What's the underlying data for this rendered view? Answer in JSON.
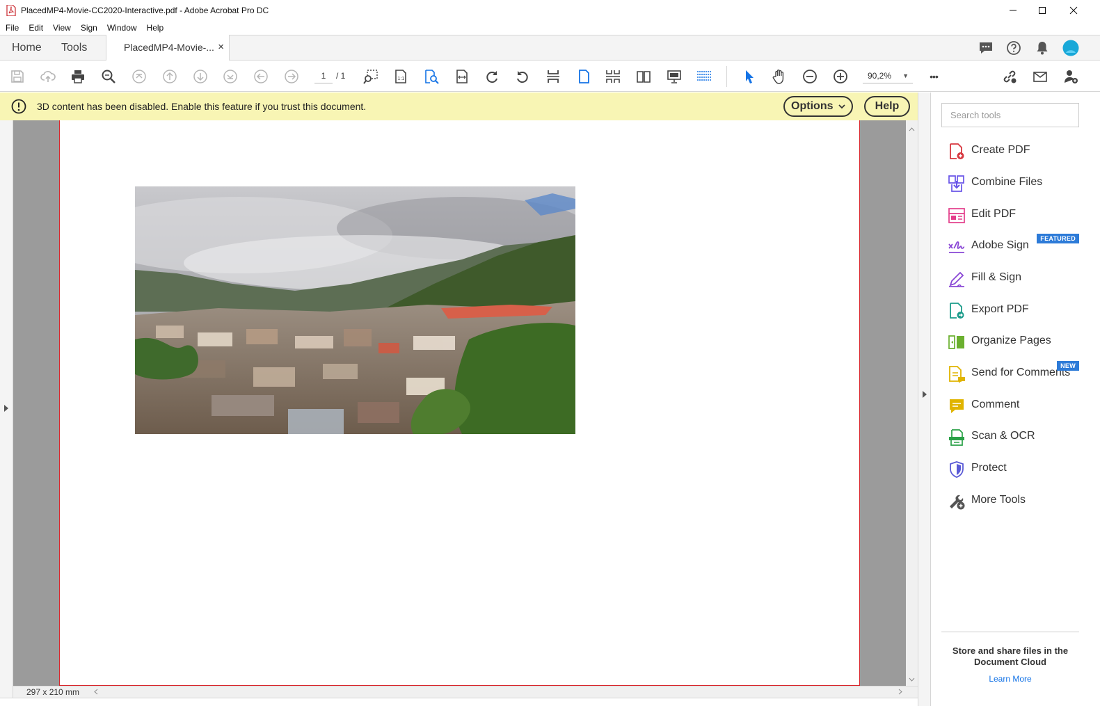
{
  "window": {
    "title": "PlacedMP4-Movie-CC2020-Interactive.pdf - Adobe Acrobat Pro DC",
    "controls": [
      "minimize-icon",
      "maximize-icon",
      "close-icon"
    ]
  },
  "menu": [
    "File",
    "Edit",
    "View",
    "Sign",
    "Window",
    "Help"
  ],
  "tabs": {
    "home": "Home",
    "tools": "Tools",
    "document": "PlacedMP4-Movie-...",
    "close_glyph": "×"
  },
  "toolbar": {
    "page_current": "1",
    "page_total": "/ 1",
    "zoom": "90,2%",
    "more": "•••"
  },
  "banner": {
    "message": "3D content has been disabled. Enable this feature if you trust this document.",
    "options_label": "Options",
    "help_label": "Help",
    "color": "#f8f5b4"
  },
  "document": {
    "page_size": "297 x 210 mm",
    "page_border_color": "#d7262c"
  },
  "tools_pane": {
    "search_placeholder": "Search tools",
    "items": [
      {
        "label": "Create PDF",
        "icon": "create-pdf-icon",
        "color": "#d7373f"
      },
      {
        "label": "Combine Files",
        "icon": "combine-files-icon",
        "color": "#6955e8"
      },
      {
        "label": "Edit PDF",
        "icon": "edit-pdf-icon",
        "color": "#e33d8a"
      },
      {
        "label": "Adobe Sign",
        "icon": "adobe-sign-icon",
        "color": "#8a47d6",
        "badge": "FEATURED"
      },
      {
        "label": "Fill & Sign",
        "icon": "fill-sign-icon",
        "color": "#8a47d6"
      },
      {
        "label": "Export PDF",
        "icon": "export-pdf-icon",
        "color": "#1c9c8b"
      },
      {
        "label": "Organize Pages",
        "icon": "organize-pages-icon",
        "color": "#6bb02f"
      },
      {
        "label": "Send for Comments",
        "icon": "send-for-comments-icon",
        "color": "#e0b400",
        "badge": "NEW"
      },
      {
        "label": "Comment",
        "icon": "comment-icon",
        "color": "#e0b400"
      },
      {
        "label": "Scan & OCR",
        "icon": "scan-ocr-icon",
        "color": "#2aa147"
      },
      {
        "label": "Protect",
        "icon": "protect-icon",
        "color": "#5a5ad6"
      },
      {
        "label": "More Tools",
        "icon": "more-tools-icon",
        "color": "#555555"
      }
    ],
    "cloud_text": "Store and share files in the Document Cloud",
    "learn_more": "Learn More"
  }
}
